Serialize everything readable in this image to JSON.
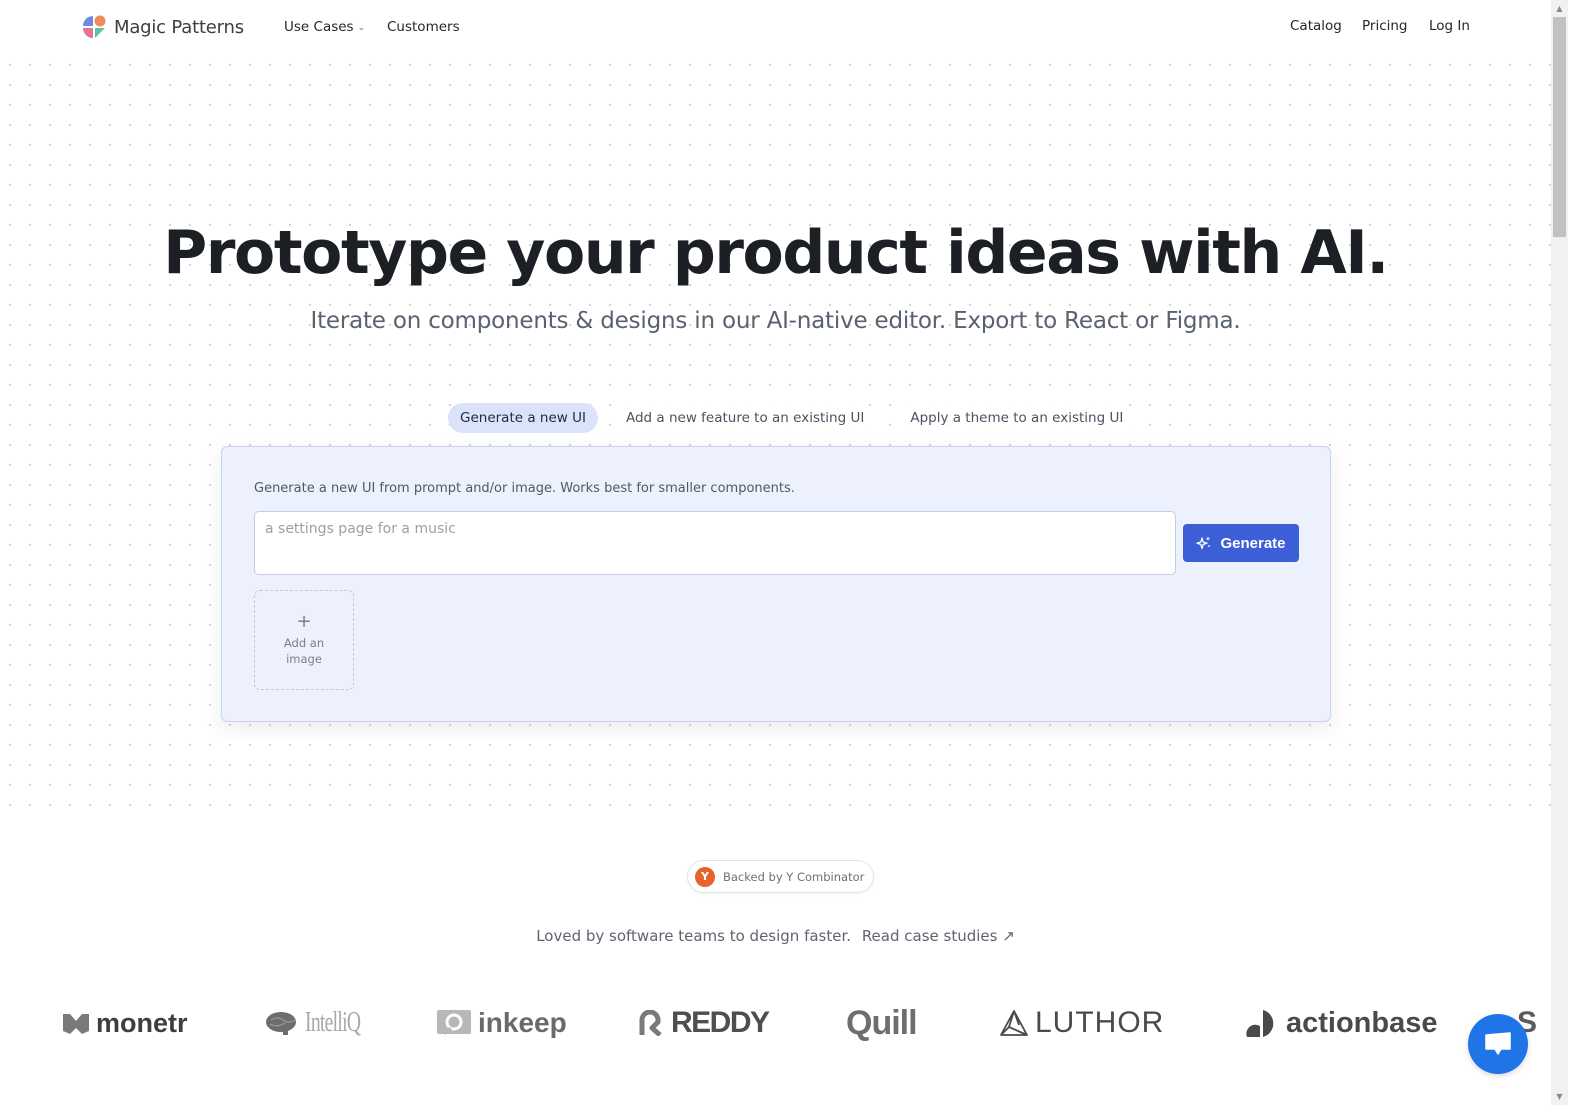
{
  "nav": {
    "brand": "Magic Patterns",
    "left_links": [
      {
        "label": "Use Cases",
        "has_dropdown": true
      },
      {
        "label": "Customers"
      }
    ],
    "right_links": [
      {
        "label": "Catalog"
      },
      {
        "label": "Pricing"
      },
      {
        "label": "Log In"
      }
    ]
  },
  "hero": {
    "title": "Prototype your product ideas with AI.",
    "subtitle": "Iterate on components & designs in our AI-native editor. Export to React or Figma."
  },
  "tabs": [
    {
      "label": "Generate a new UI",
      "active": true
    },
    {
      "label": "Add a new feature to an existing UI",
      "active": false
    },
    {
      "label": "Apply a theme to an existing UI",
      "active": false
    }
  ],
  "generator": {
    "description": "Generate a new UI from prompt and/or image. Works best for smaller components.",
    "prompt_placeholder": "a settings page for a music",
    "prompt_value": "",
    "generate_label": "Generate",
    "add_image_icon": "+",
    "add_image_label": "Add an image"
  },
  "badge": {
    "logo_letter": "Y",
    "text": "Backed by Y Combinator"
  },
  "social_proof": {
    "text": "Loved by software teams to design faster.",
    "link_label": "Read case studies ↗"
  },
  "customer_logos": [
    "monetr",
    "IntelliQ",
    "inkeep",
    "REDDY",
    "Quill",
    "LUTHOR",
    "actionbase",
    "S"
  ],
  "colors": {
    "accent": "#3c5fd8",
    "tab_active_bg": "#dbe3fb",
    "card_bg": "#edf1fd",
    "yc_orange": "#e8632b",
    "chat_blue": "#1f74e8"
  }
}
